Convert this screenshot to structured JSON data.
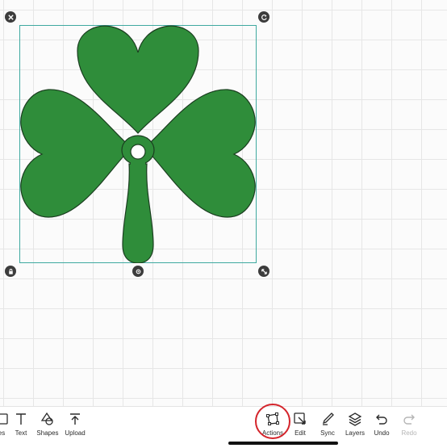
{
  "canvas": {
    "shape_color": "#2f8d3a",
    "selection_color": "#3fa9a0",
    "handles": [
      "close-icon",
      "rotate-icon",
      "lock-icon",
      "move-icon",
      "resize-icon"
    ]
  },
  "toolbar": {
    "left_items": [
      {
        "label": "es",
        "icon": "images-icon"
      },
      {
        "label": "Text",
        "icon": "text-icon"
      },
      {
        "label": "Shapes",
        "icon": "shapes-icon"
      },
      {
        "label": "Upload",
        "icon": "upload-icon"
      }
    ],
    "right_items": [
      {
        "label": "Actions",
        "icon": "actions-icon"
      },
      {
        "label": "Edit",
        "icon": "edit-icon"
      },
      {
        "label": "Sync",
        "icon": "sync-icon"
      },
      {
        "label": "Layers",
        "icon": "layers-icon"
      },
      {
        "label": "Undo",
        "icon": "undo-icon"
      },
      {
        "label": "Redo",
        "icon": "redo-icon"
      }
    ],
    "highlight_color": "#d4242b"
  }
}
